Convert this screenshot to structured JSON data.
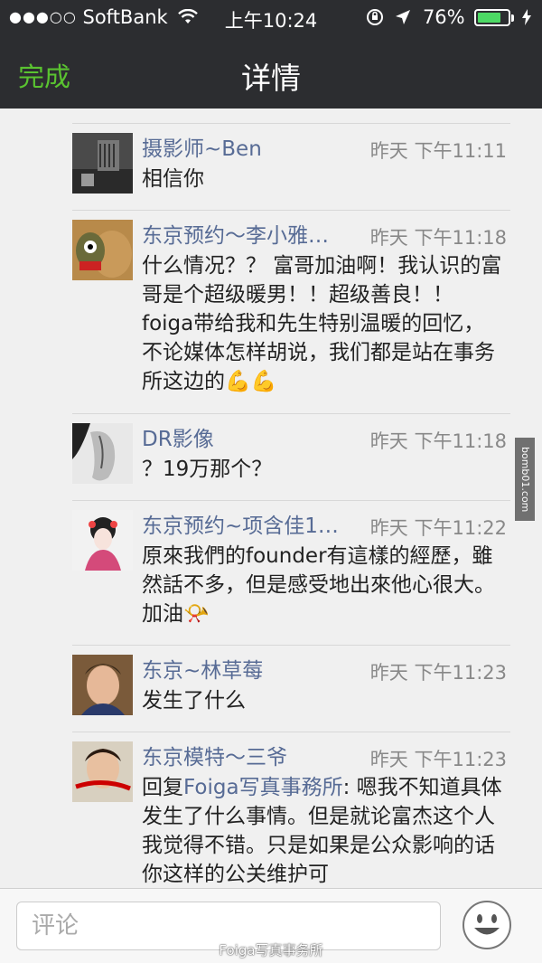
{
  "status": {
    "carrier": "SoftBank",
    "time": "上午10:24",
    "battery": "76%",
    "battery_level": 0.76
  },
  "nav": {
    "done": "完成",
    "title": "详情"
  },
  "comments": [
    {
      "name": "摄影师~Ben",
      "time": "昨天 下午11:11",
      "text": "相信你"
    },
    {
      "name": "东京预约～李小雅…",
      "time": "昨天 下午11:18",
      "text": "什么情况？？ 富哥加油啊！我认识的富哥是个超级暖男！！超级善良！！foiga带给我和先生特别温暖的回忆，不论媒体怎样胡说，我们都是站在事务所这边的💪💪"
    },
    {
      "name": "DR影像",
      "time": "昨天 下午11:18",
      "text": "？19万那个？"
    },
    {
      "name": "东京预约~项含佳1…",
      "time": "昨天 下午11:22",
      "text": "原來我們的founder有這樣的經歷，雖然話不多，但是感受地出來他心很大。加油📯"
    },
    {
      "name": "东京~林草莓",
      "time": "昨天 下午11:23",
      "text": "发生了什么"
    },
    {
      "name": "东京模特～三爷",
      "time": "昨天 下午11:23",
      "reply_prefix": "回复",
      "reply_target": "Foiga写真事務所",
      "text": ": 嗯我不知道具体发生了什么事情。但是就论富杰这个人我觉得不错。只是如果是公众影响的话你这样的公关维护可"
    }
  ],
  "side_watermark": "bomb01.com",
  "input": {
    "placeholder": "评论"
  },
  "bottom_watermark": "Foiga写真事务所"
}
